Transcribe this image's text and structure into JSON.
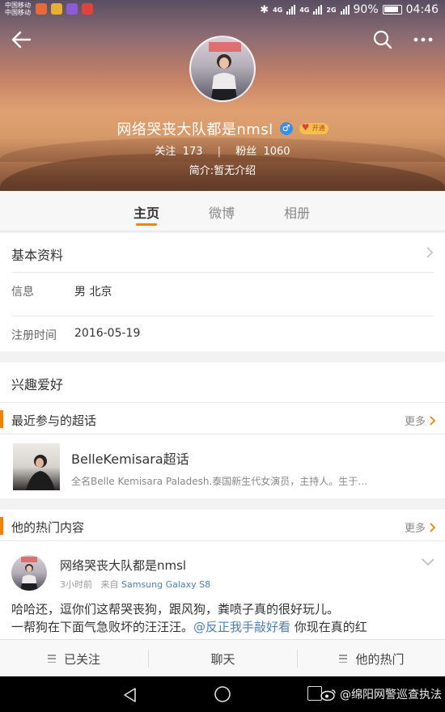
{
  "status_bar": {
    "carrier_1": "中国移动",
    "carrier_2": "中国移动",
    "network_1": "4G",
    "network_2": "4G",
    "network_3": "2G",
    "battery": "90%",
    "time": "04:46"
  },
  "profile": {
    "username": "网络哭丧大队都是nmsl",
    "gender_symbol": "♂",
    "vip_label": "开通",
    "following_label": "关注",
    "following_count": "173",
    "separator": "|",
    "followers_label": "粉丝",
    "followers_count": "1060",
    "bio": "简介:暂无介绍"
  },
  "tabs": [
    {
      "label": "主页",
      "active": true
    },
    {
      "label": "微博",
      "active": false
    },
    {
      "label": "相册",
      "active": false
    }
  ],
  "basic_info": {
    "title": "基本资料",
    "info_label": "信息",
    "info_value": "男  北京",
    "reg_label": "注册时间",
    "reg_value": "2016-05-19"
  },
  "interests": {
    "title": "兴趣爱好"
  },
  "super_topics": {
    "title": "最近参与的超话",
    "more": "更多",
    "topic_name": "BelleKemisara超话",
    "topic_desc": "全名Belle Kemisara Paladesh.泰国新生代女演员，主持人。生于…"
  },
  "hot_content": {
    "title": "他的热门内容",
    "more": "更多",
    "post_author": "网络哭丧大队都是nmsl",
    "post_time": "3小时前",
    "post_from_label": "来自",
    "post_source": "Samsung Galaxy S8",
    "post_text_1": "哈哈还，逗你们这帮哭丧狗，跟风狗，粪喷子真的很好玩儿。",
    "post_text_2": "一帮狗在下面气急败坏的汪汪汪。",
    "post_mention": "@反正我手敲好看",
    "post_text_3": " 你现在真的红"
  },
  "actions": {
    "followed": "已关注",
    "chat": "聊天",
    "hot": "他的热门"
  },
  "watermark": "@绵阳网警巡查执法",
  "colors": {
    "accent": "#f08300",
    "link": "#4a7fb8"
  }
}
